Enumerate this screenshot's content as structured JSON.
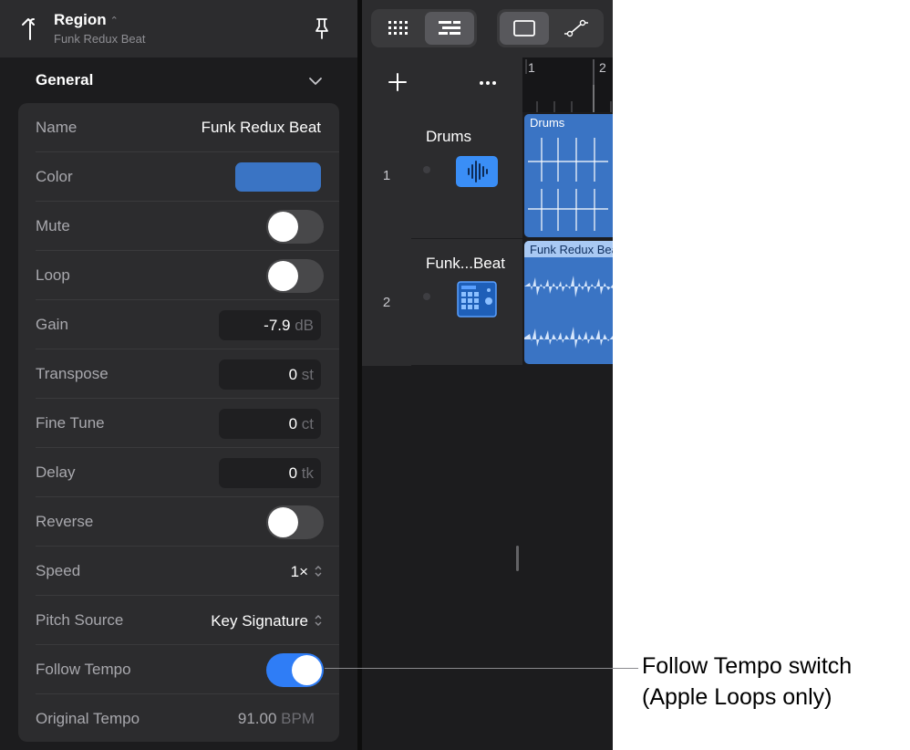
{
  "inspector": {
    "title": "Region",
    "subtitle": "Funk Redux Beat",
    "section_title": "General",
    "properties": {
      "name": {
        "label": "Name",
        "value": "Funk Redux Beat"
      },
      "color": {
        "label": "Color",
        "swatch": "#3a74c4"
      },
      "mute": {
        "label": "Mute",
        "on": false
      },
      "loop": {
        "label": "Loop",
        "on": false
      },
      "gain": {
        "label": "Gain",
        "value": "-7.9",
        "unit": "dB"
      },
      "transpose": {
        "label": "Transpose",
        "value": "0",
        "unit": "st"
      },
      "fine_tune": {
        "label": "Fine Tune",
        "value": "0",
        "unit": "ct"
      },
      "delay": {
        "label": "Delay",
        "value": "0",
        "unit": "tk"
      },
      "reverse": {
        "label": "Reverse",
        "on": false
      },
      "speed": {
        "label": "Speed",
        "value": "1×"
      },
      "pitch_source": {
        "label": "Pitch Source",
        "value": "Key Signature"
      },
      "follow_tempo": {
        "label": "Follow Tempo",
        "on": true
      },
      "original_tempo": {
        "label": "Original Tempo",
        "value": "91.00",
        "unit": "BPM"
      }
    }
  },
  "tracks_view": {
    "ruler": [
      "1",
      "2"
    ],
    "tracks": [
      {
        "number": "1",
        "name": "Drums",
        "region_name": "Drums",
        "icon": "waveform-icon"
      },
      {
        "number": "2",
        "name": "Funk...Beat",
        "region_name": "Funk Redux Beat",
        "icon": "drum-machine-icon"
      }
    ]
  },
  "callout": {
    "line1": "Follow Tempo switch",
    "line2": "(Apple Loops only)"
  },
  "colors": {
    "accent": "#2f7df6",
    "region_blue": "#3a74c4",
    "panel_bg": "#1c1c1e",
    "row_bg": "#2c2c2e"
  }
}
